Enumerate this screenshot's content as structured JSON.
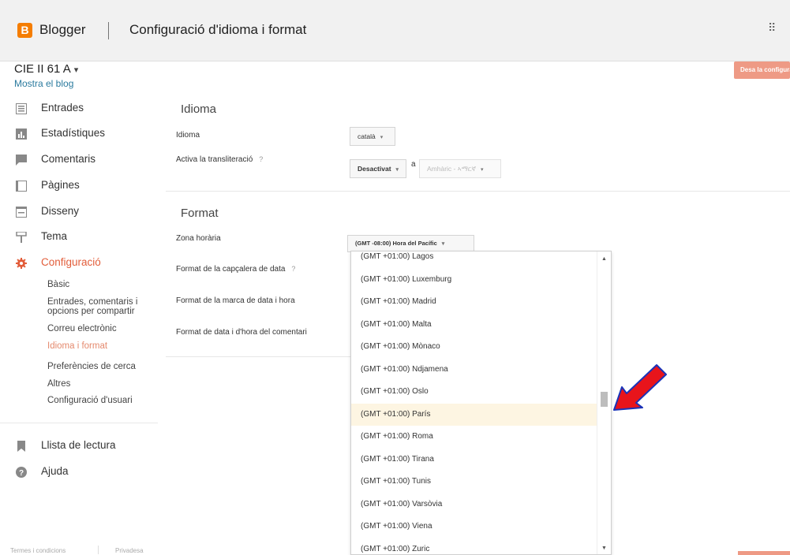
{
  "header": {
    "logo_letter": "B",
    "brand": "Blogger",
    "title": "Configuració d'idioma i format",
    "apps_icon": "apps-grid-icon",
    "apps_glyph": "⠿"
  },
  "sidebar": {
    "blog_name": "CIE II 61 A",
    "blog_caret": "▾",
    "view_blog": "Mostra el blog",
    "items": [
      {
        "label": "Entrades",
        "icon": "posts-icon"
      },
      {
        "label": "Estadístiques",
        "icon": "stats-icon"
      },
      {
        "label": "Comentaris",
        "icon": "comments-icon"
      },
      {
        "label": "Pàgines",
        "icon": "pages-icon"
      },
      {
        "label": "Disseny",
        "icon": "layout-icon"
      },
      {
        "label": "Tema",
        "icon": "theme-icon"
      },
      {
        "label": "Configuració",
        "icon": "gear-icon"
      }
    ],
    "sub_items": [
      "Bàsic",
      "Entrades, comentaris i",
      "opcions per compartir",
      "Correu electrònic",
      "Idioma i format",
      "Preferències de cerca",
      "Altres",
      "Configuració d'usuari"
    ],
    "bottom_items": [
      {
        "label": "Llista de lectura",
        "icon": "bookmark-icon"
      },
      {
        "label": "Ajuda",
        "icon": "help-icon"
      }
    ],
    "footer": {
      "terms": "Termes i condicions",
      "privacy": "Privadesa"
    }
  },
  "main": {
    "save_button": "Desa la configuració",
    "language_section": {
      "title": "Idioma",
      "language_label": "Idioma",
      "language_value": "català",
      "transliteration_label": "Activa la transliteració",
      "help_mark": "?",
      "transliteration_value": "Desactivat",
      "a_label": "a",
      "transliteration_target": "Amhàric - ኣማርኛ"
    },
    "format_section": {
      "title": "Format",
      "timezone_label": "Zona horària",
      "timezone_value": "(GMT -08:00) Hora del Pacífic",
      "date_header_label": "Format de la capçalera de data",
      "timestamp_label": "Format de la marca de data i hora",
      "comment_date_label": "Format de data i d'hora del comentari"
    },
    "dropdown_arrow": "▾",
    "timezone_options": [
      "(GMT +01:00) Lagos",
      "(GMT +01:00) Luxemburg",
      "(GMT +01:00) Madrid",
      "(GMT +01:00) Malta",
      "(GMT +01:00) Mònaco",
      "(GMT +01:00) Ndjamena",
      "(GMT +01:00) Oslo",
      "(GMT +01:00) París",
      "(GMT +01:00) Roma",
      "(GMT +01:00) Tirana",
      "(GMT +01:00) Tunis",
      "(GMT +01:00) Varsòvia",
      "(GMT +01:00) Viena",
      "(GMT +01:00) Zuric"
    ],
    "selected_timezone_index": 7,
    "scroll_up": "▲",
    "scroll_down": "▼"
  },
  "colors": {
    "accent": "#e25d3a",
    "logo": "#f57d00",
    "save_button": "#ee9a85",
    "annotation_arrow": "#e8141b"
  }
}
